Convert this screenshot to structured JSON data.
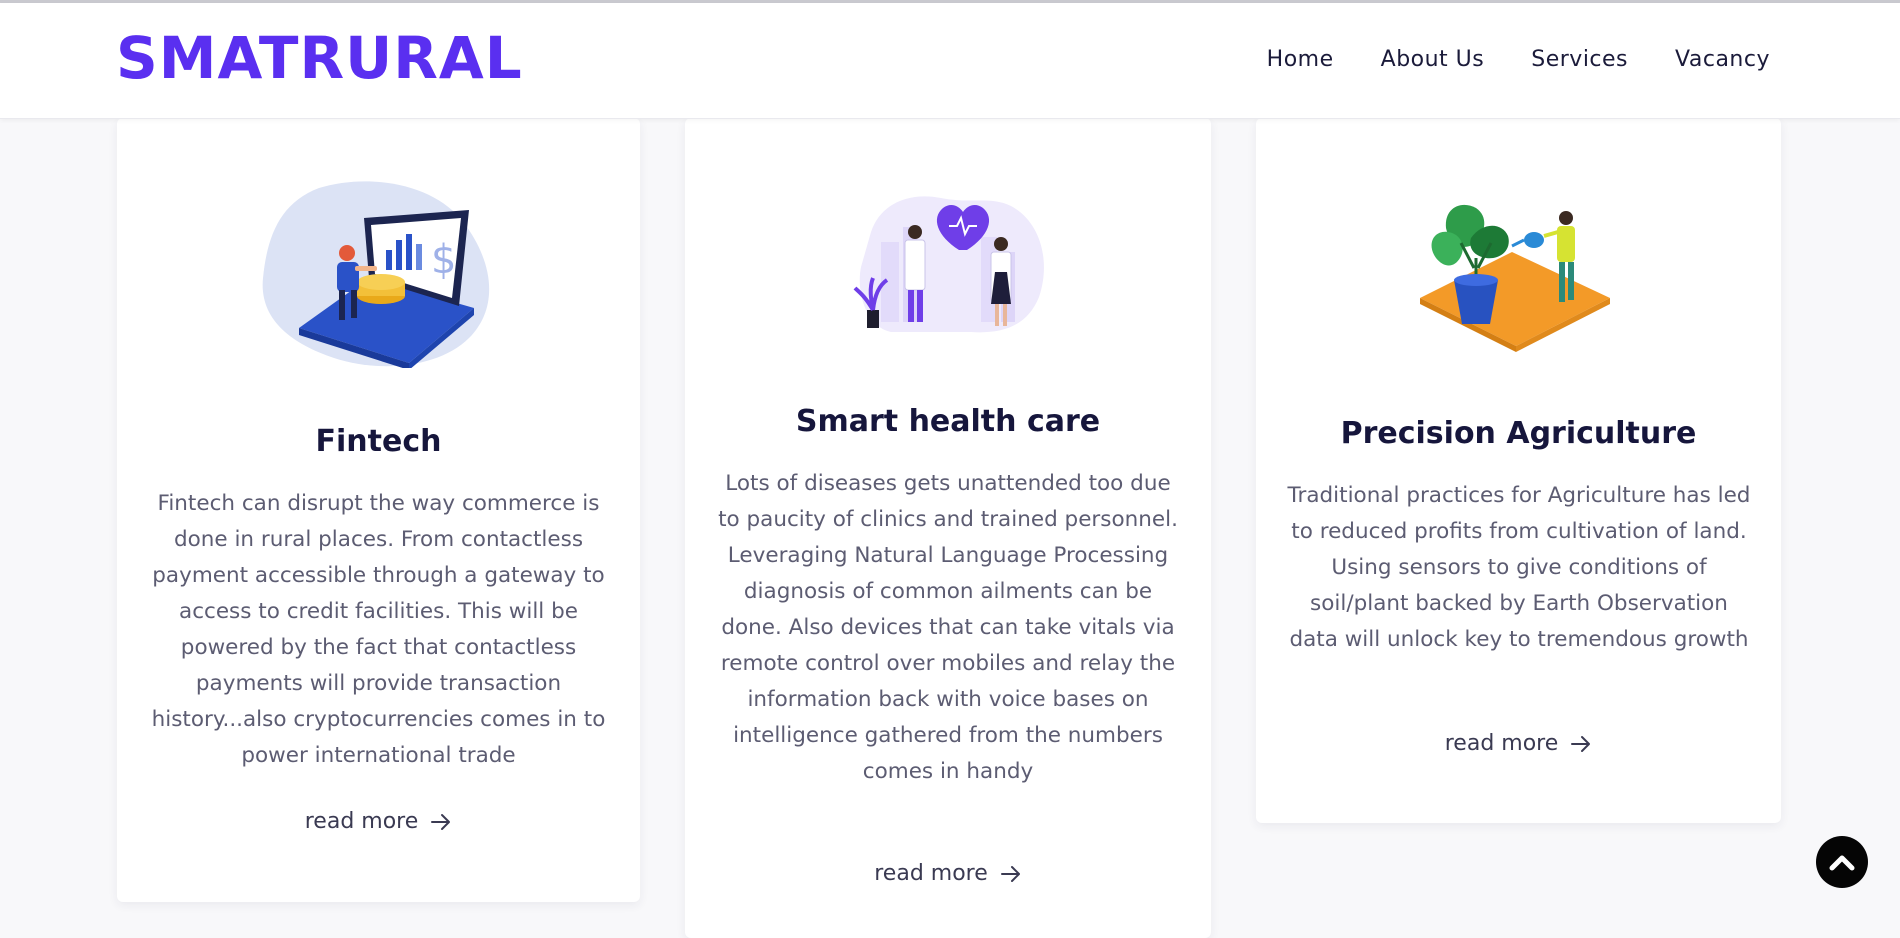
{
  "header": {
    "logo": "SMATRURAL",
    "nav": [
      {
        "label": "Home"
      },
      {
        "label": "About Us"
      },
      {
        "label": "Services"
      },
      {
        "label": "Vacancy"
      }
    ]
  },
  "cards": [
    {
      "title": "Fintech",
      "description": "Fintech can disrupt the way commerce is done in rural places. From contactless payment accessible through a gateway to access to credit facilities. This will be powered by the fact that contactless payments will provide transaction history...also cryptocurrencies comes in to power international trade",
      "read_more": "read more",
      "illustration": "fintech-laptop-illustration"
    },
    {
      "title": "Smart health care",
      "description": "Lots of diseases gets unattended too due to paucity of clinics and trained personnel. Leveraging Natural Language Processing diagnosis of common ailments can be done. Also devices that can take vitals via remote control over mobiles and relay the information back with voice bases on intelligence gathered from the numbers comes in handy",
      "read_more": "read more",
      "illustration": "doctors-heart-illustration"
    },
    {
      "title": "Precision Agriculture",
      "description": "Traditional practices for Agriculture has led to reduced profits from cultivation of land. Using sensors to give conditions of soil/plant backed by Earth Observation data will unlock key to tremendous growth",
      "read_more": "read more",
      "illustration": "plant-watering-illustration"
    }
  ],
  "scroll_top": {
    "icon": "chevron-up-icon"
  },
  "colors": {
    "brand": "#5a2ff0",
    "heading": "#16163c",
    "body_text": "#5c5c72",
    "scroll_button": "#050505"
  }
}
